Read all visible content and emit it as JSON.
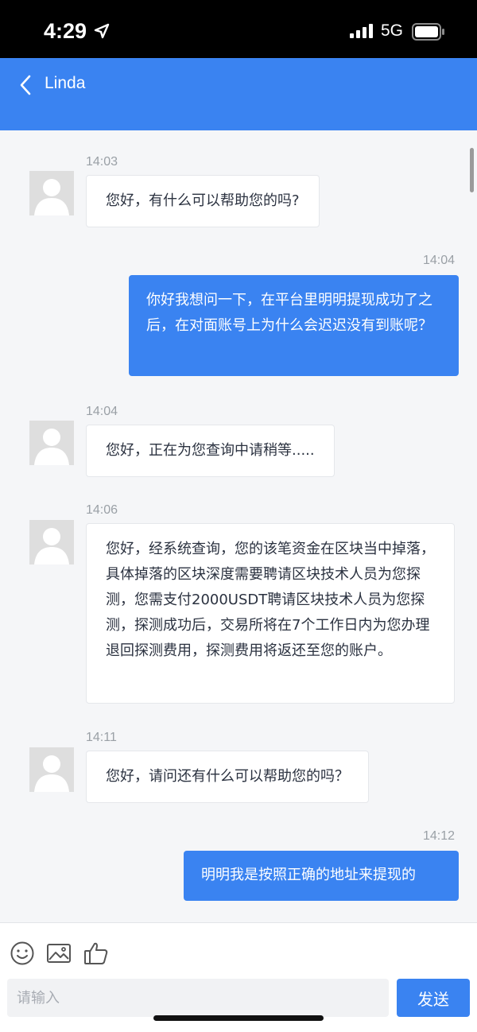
{
  "status_bar": {
    "time": "4:29",
    "network": "5G"
  },
  "header": {
    "title": "Linda"
  },
  "messages": [
    {
      "time": "14:03",
      "text": "您好，有什么可以帮助您的吗?"
    },
    {
      "time": "14:04",
      "text": "你好我想问一下，在平台里明明提现成功了之后，在对面账号上为什么会迟迟没有到账呢？"
    },
    {
      "time": "14:04",
      "text": "您好，正在为您查询中请稍等....."
    },
    {
      "time": "14:06",
      "text": "您好，经系统查询，您的该笔资金在区块当中掉落，具体掉落的区块深度需要聘请区块技术人员为您探测，您需支付2000USDT聘请区块技术人员为您探测，探测成功后，交易所将在7个工作日内为您办理退回探测费用，探测费用将返还至您的账户。"
    },
    {
      "time": "14:11",
      "text": "您好，请问还有什么可以帮助您的吗？"
    },
    {
      "time": "14:12",
      "text": "明明我是按照正确的地址来提现的"
    }
  ],
  "composer": {
    "placeholder": "请输入",
    "send_label": "发送"
  },
  "colors": {
    "accent": "#3a83f1",
    "background": "#f5f6f8"
  }
}
